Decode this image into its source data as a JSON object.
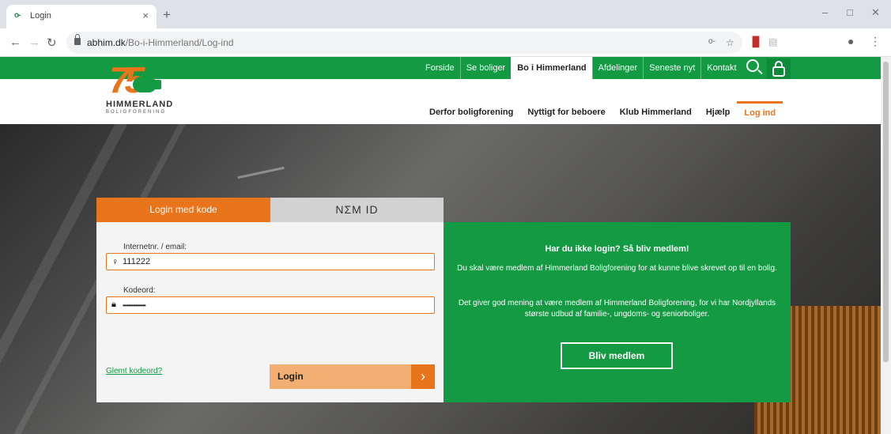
{
  "browser": {
    "tab_title": "Login",
    "tab_favicon": "key-icon",
    "url_host": "abhim.dk",
    "url_path": "/Bo-i-Himmerland/Log-ind"
  },
  "logo": {
    "number": "75",
    "title": "HIMMERLAND",
    "subtitle": "BOLIGFORENING"
  },
  "topnav": {
    "items": [
      {
        "label": "Forside"
      },
      {
        "label": "Se boliger"
      },
      {
        "label": "Bo i Himmerland"
      },
      {
        "label": "Afdelinger"
      },
      {
        "label": "Seneste nyt"
      },
      {
        "label": "Kontakt"
      }
    ],
    "active_index": 2
  },
  "subnav": {
    "items": [
      {
        "label": "Derfor boligforening"
      },
      {
        "label": "Nyttigt for beboere"
      },
      {
        "label": "Klub Himmerland"
      },
      {
        "label": "Hjælp"
      },
      {
        "label": "Log ind"
      }
    ],
    "active_index": 4
  },
  "login": {
    "tab_code": "Login med kode",
    "tab_nemid": "NΣM ID",
    "user_label": "Internetnr. / email:",
    "user_value": "111222",
    "pass_label": "Kodeord:",
    "pass_value": "••••••••••••••••",
    "forgot": "Glemt kodeord?",
    "submit": "Login"
  },
  "signup": {
    "title": "Har du ikke login? Så bliv medlem!",
    "p1": "Du skal være medlem af Himmerland Boligforening for at kunne blive skrevet op til en bolig.",
    "p2": "Det giver god mening at være medlem af Himmerland Boligforening, for vi har Nordjyllands største udbud af familie-, ungdoms- og seniorboliger.",
    "button": "Bliv medlem"
  },
  "colors": {
    "brand_green": "#139a43",
    "brand_orange": "#e8741b"
  }
}
